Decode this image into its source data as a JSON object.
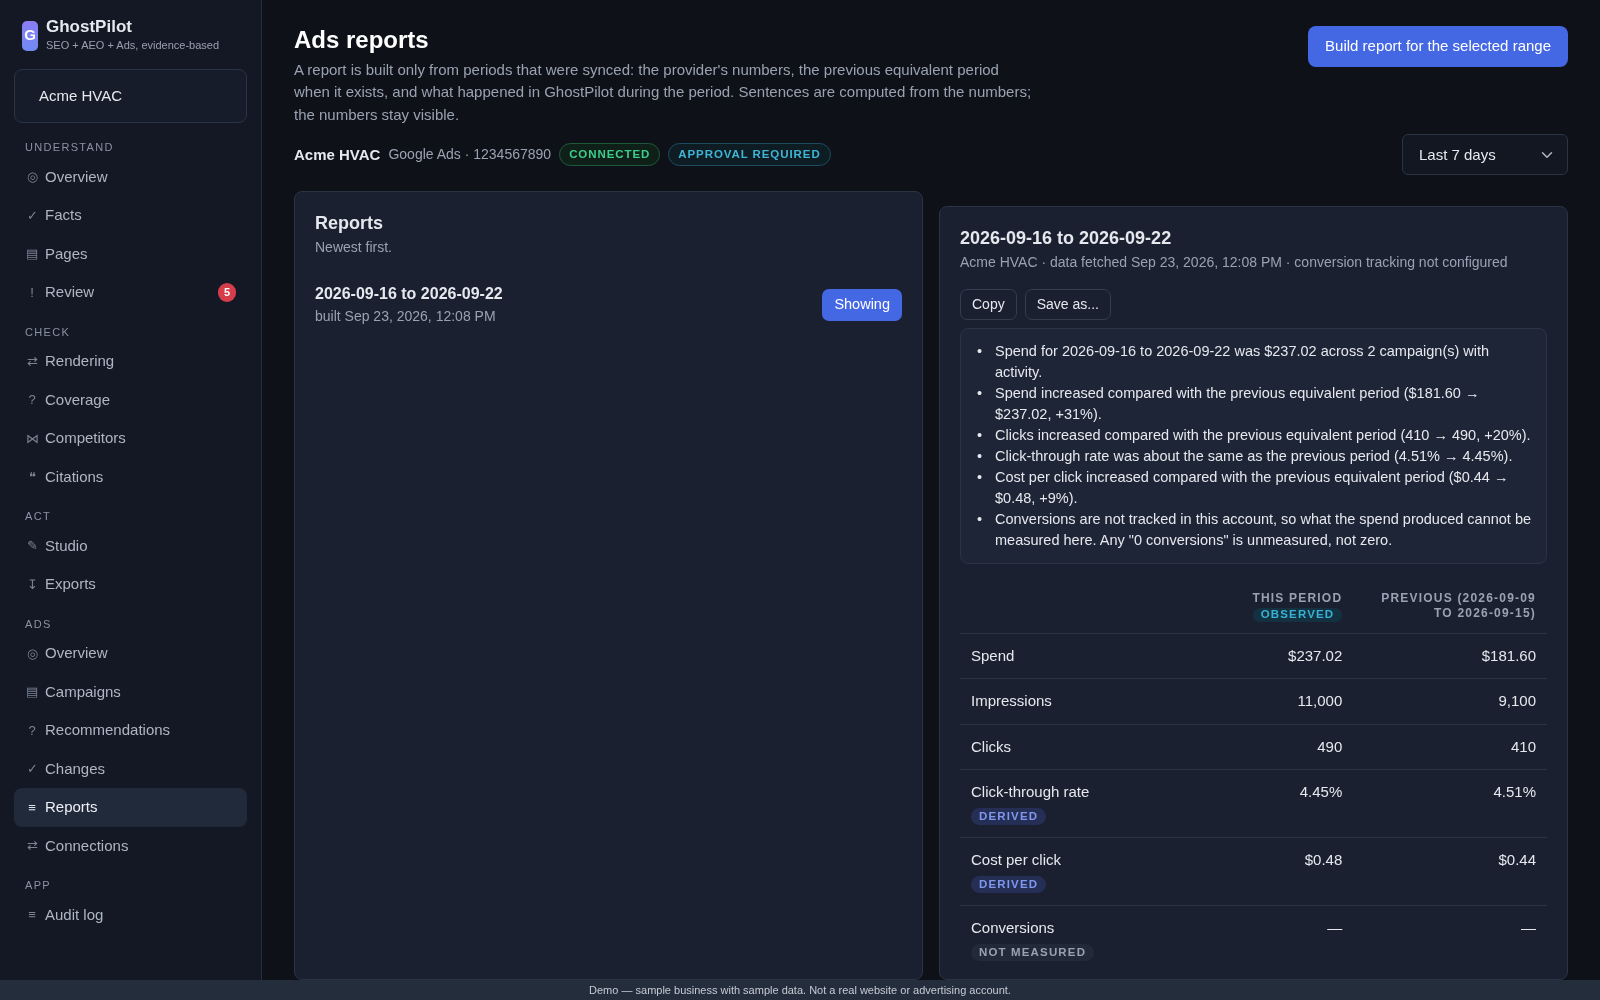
{
  "brand": {
    "logo_letter": "G",
    "name": "GhostPilot",
    "tagline": "SEO + AEO + Ads, evidence-based"
  },
  "workspace_select": {
    "value": "Acme HVAC"
  },
  "sidebar": {
    "sections": [
      {
        "title": "UNDERSTAND",
        "items": [
          {
            "icon": "◎",
            "label": "Overview",
            "selected": false
          },
          {
            "icon": "✓",
            "label": "Facts",
            "selected": false
          },
          {
            "icon": "▤",
            "label": "Pages",
            "selected": false
          },
          {
            "icon": "!",
            "label": "Review",
            "selected": false,
            "badge": "5"
          }
        ]
      },
      {
        "title": "CHECK",
        "items": [
          {
            "icon": "⇄",
            "label": "Rendering",
            "selected": false
          },
          {
            "icon": "?",
            "label": "Coverage",
            "selected": false
          },
          {
            "icon": "⋈",
            "label": "Competitors",
            "selected": false
          },
          {
            "icon": "❝",
            "label": "Citations",
            "selected": false
          }
        ]
      },
      {
        "title": "ACT",
        "items": [
          {
            "icon": "✎",
            "label": "Studio",
            "selected": false
          },
          {
            "icon": "↧",
            "label": "Exports",
            "selected": false
          }
        ]
      },
      {
        "title": "ADS",
        "items": [
          {
            "icon": "◎",
            "label": "Overview",
            "selected": false
          },
          {
            "icon": "▤",
            "label": "Campaigns",
            "selected": false
          },
          {
            "icon": "?",
            "label": "Recommendations",
            "selected": false
          },
          {
            "icon": "✓",
            "label": "Changes",
            "selected": false
          },
          {
            "icon": "≡",
            "label": "Reports",
            "selected": true
          },
          {
            "icon": "⇄",
            "label": "Connections",
            "selected": false
          }
        ]
      },
      {
        "title": "APP",
        "items": [
          {
            "icon": "≡",
            "label": "Audit log",
            "selected": false
          }
        ]
      }
    ]
  },
  "header": {
    "title": "Ads reports",
    "description": "A report is built only from periods that were synced: the provider's numbers, the previous equivalent period when it exists, and what happened in GhostPilot during the period. Sentences are computed from the numbers; the numbers stay visible.",
    "build_button": "Build report for the selected range"
  },
  "account": {
    "name": "Acme HVAC",
    "detail": "Google Ads · 1234567890",
    "badges": [
      {
        "kind": "success",
        "label": "CONNECTED"
      },
      {
        "kind": "info",
        "label": "APPROVAL REQUIRED"
      }
    ]
  },
  "range_select": {
    "value": "Last 7 days"
  },
  "reports_list": {
    "title": "Reports",
    "subtitle": "Newest first.",
    "items": [
      {
        "title": "2026-09-16 to 2026-09-22",
        "built": "built Sep 23, 2026, 12:08 PM",
        "button": "Showing",
        "selected": true
      }
    ]
  },
  "report": {
    "title": "2026-09-16 to 2026-09-22",
    "meta": "Acme HVAC · data fetched Sep 23, 2026, 12:08 PM · conversion tracking not configured",
    "buttons": [
      "Copy",
      "Save as..."
    ],
    "summary": [
      {
        "marker": "•",
        "text": "Spend for 2026-09-16 to 2026-09-22 was $237.02 across 2 campaign(s) with activity."
      },
      {
        "marker": "•",
        "text": "Spend increased compared with the previous equivalent period ($181.60 → $237.02, +31%)."
      },
      {
        "marker": "•",
        "text": "Clicks increased compared with the previous equivalent period (410 → 490, +20%)."
      },
      {
        "marker": "•",
        "text": "Click-through rate was about the same as the previous period (4.51% → 4.45%)."
      },
      {
        "marker": "•",
        "text": "Cost per click increased compared with the previous equivalent period ($0.44 → $0.48, +9%)."
      },
      {
        "marker": "•",
        "text": "Conversions are not tracked in this account, so what the spend produced cannot be measured here. Any \"0 conversions\" is unmeasured, not zero."
      }
    ],
    "table": {
      "columns": [
        {
          "label": "THIS PERIOD",
          "badge": {
            "kind": "observed",
            "label": "OBSERVED"
          }
        },
        {
          "label": "PREVIOUS (2026-09-09 TO 2026-09-15)"
        }
      ],
      "rows": [
        {
          "metric": "Spend",
          "this": "$237.02",
          "previous": "$181.60"
        },
        {
          "metric": "Impressions",
          "this": "11,000",
          "previous": "9,100"
        },
        {
          "metric": "Clicks",
          "this": "490",
          "previous": "410"
        },
        {
          "metric": "Click-through rate",
          "badge": {
            "kind": "derived",
            "label": "DERIVED"
          },
          "this": "4.45%",
          "previous": "4.51%"
        },
        {
          "metric": "Cost per click",
          "badge": {
            "kind": "derived",
            "label": "DERIVED"
          },
          "this": "$0.48",
          "previous": "$0.44"
        },
        {
          "metric": "Conversions",
          "badge": {
            "kind": "not_measured",
            "label": "NOT MEASURED"
          },
          "this": "—",
          "previous": "—"
        }
      ]
    }
  },
  "footer": "Demo — sample business with sample data. Not a real website or advertising account."
}
